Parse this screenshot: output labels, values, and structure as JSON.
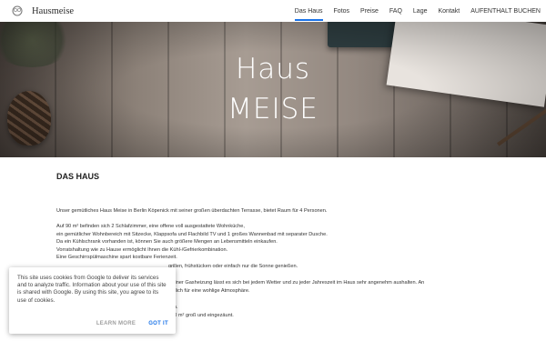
{
  "header": {
    "site_title": "Hausmeise",
    "nav": [
      {
        "label": "Das Haus",
        "active": true
      },
      {
        "label": "Fotos"
      },
      {
        "label": "Preise"
      },
      {
        "label": "FAQ"
      },
      {
        "label": "Lage"
      },
      {
        "label": "Kontakt"
      },
      {
        "label": "AUFENTHALT BUCHEN"
      }
    ]
  },
  "hero": {
    "line1": "Haus",
    "line2": "MEISE"
  },
  "main": {
    "heading": "DAS HAUS",
    "paragraphs": [
      "Unser gemütliches Haus Meise in Berlin Köpenick mit seiner großen überdachten Terrasse, bietet Raum für 4 Personen.",
      "Auf 90 m² befinden sich 2 Schlafzimmer, eine offene voll ausgestattete Wohnküche,",
      "ein gemütlicher Wohnbereich mit  Sitzecke, Klappsofa und Flachbild TV und 1 großes Wannenbad mit separater Dusche.",
      "Da ein Kühlschrank vorhanden ist, können Sie auch größere Mengen an Lebensmitteln einkaufen.",
      "Vorratshaltung wie zu Hause ermöglicht Ihnen die Kühl-/Gefrierkombination.",
      "Eine Geschirrspülmaschine spart kostbare Ferienzeit.",
      "grillen, frühstücken oder einfach nur die Sonne genießen.",
      "k einer Gasheizung  lässt es sich bei jedem Wetter und zu jeder Jahreszeit im Haus sehr angenehm aushalten. An",
      "ätzlich für eine wohlige Atmosphäre.",
      "sen.",
      "000 m² groß und eingezäunt."
    ]
  },
  "cookie_banner": {
    "text": "This site uses cookies from Google to deliver its services and to analyze traffic. Information about your use of this site is shared with Google. By using this site, you agree to its use of cookies.",
    "learn_more": "LEARN MORE",
    "got_it": "GOT IT"
  }
}
